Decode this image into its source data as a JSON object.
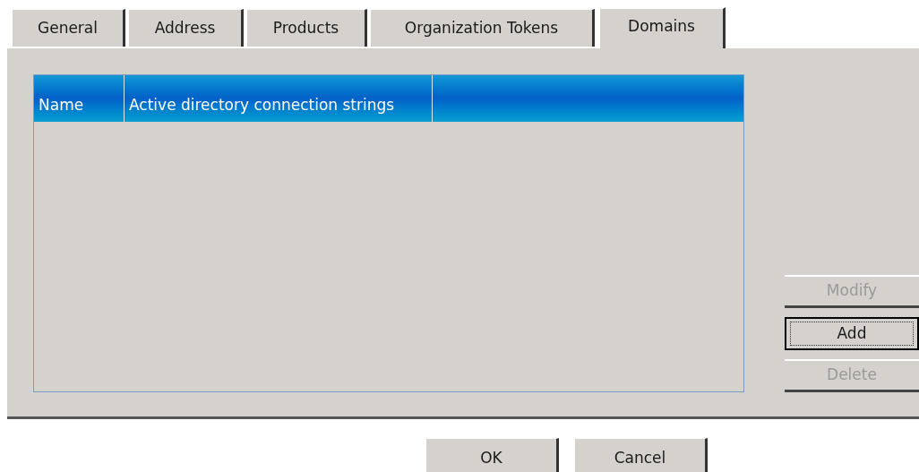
{
  "tabs": [
    {
      "label": "General",
      "selected": false
    },
    {
      "label": "Address",
      "selected": false
    },
    {
      "label": "Products",
      "selected": false
    },
    {
      "label": "Organization Tokens",
      "selected": false
    },
    {
      "label": "Domains",
      "selected": true
    }
  ],
  "table": {
    "columns": [
      "Name",
      "Active directory connection strings"
    ]
  },
  "side_buttons": [
    {
      "label": "Modify",
      "disabled": true,
      "focused": false
    },
    {
      "label": "Add",
      "disabled": false,
      "focused": true
    },
    {
      "label": "Delete",
      "disabled": true,
      "focused": false
    }
  ],
  "dialog_buttons": [
    "OK",
    "Cancel"
  ]
}
